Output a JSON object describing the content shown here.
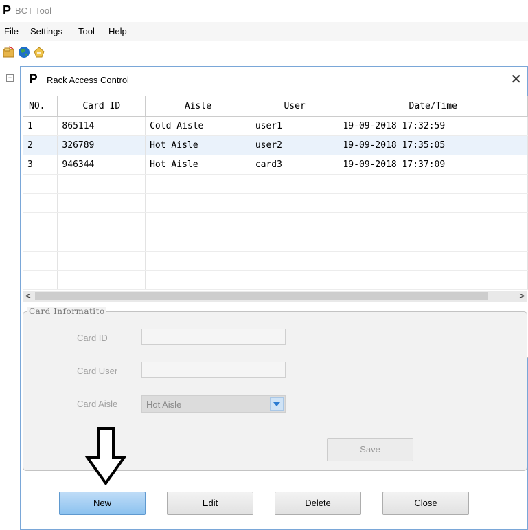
{
  "app": {
    "logo": "P",
    "title": "BCT Tool",
    "menu": [
      "File",
      "Settings",
      "Tool",
      "Help"
    ],
    "toolbar_icons": [
      "open-folder-icon",
      "globe-icon",
      "export-icon"
    ]
  },
  "dialog": {
    "logo": "P",
    "title": "Rack Access Control",
    "close_glyph": "✕",
    "table": {
      "columns": [
        "NO.",
        "Card ID",
        "Aisle",
        "User",
        "Date/Time"
      ],
      "rows": [
        [
          "1",
          "865114",
          "Cold Aisle",
          "user1",
          "19-09-2018 17:32:59"
        ],
        [
          "2",
          "326789",
          "Hot Aisle",
          "user2",
          "19-09-2018 17:35:05"
        ],
        [
          "3",
          "946344",
          "Hot Aisle",
          "card3",
          "19-09-2018 17:37:09"
        ]
      ]
    },
    "scroll": {
      "left": "<",
      "right": ">"
    },
    "card_info": {
      "legend": "Card Informatito",
      "card_id_label": "Card ID",
      "card_id_value": "",
      "card_user_label": "Card User",
      "card_user_value": "",
      "card_aisle_label": "Card Aisle",
      "card_aisle_value": "Hot Aisle",
      "save_label": "Save"
    },
    "buttons": {
      "new": "New",
      "edit": "Edit",
      "delete": "Delete",
      "close": "Close"
    }
  },
  "colors": {
    "accent": "#8cc2ef",
    "dialog_border": "#7aa7d8",
    "row_highlight": "#eaf2fb"
  }
}
